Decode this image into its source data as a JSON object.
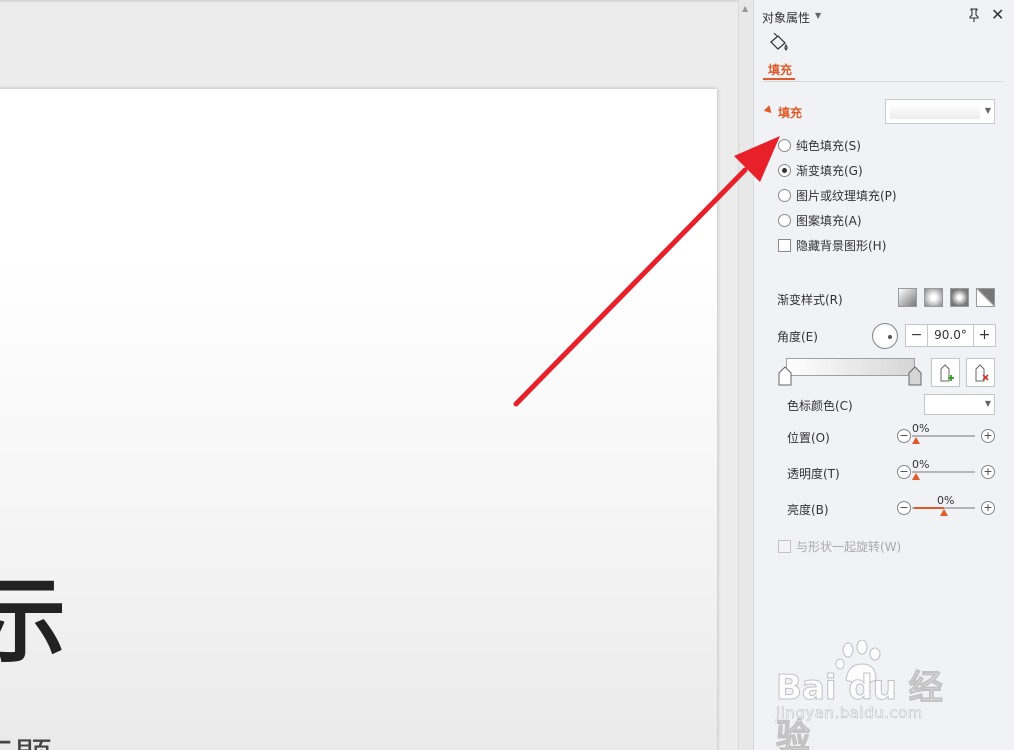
{
  "slide": {
    "title_fragment": "示",
    "subtitle_fragment": "标题"
  },
  "panel": {
    "title": "对象属性",
    "tab_fill_label": "填充",
    "fill_section_label": "填充",
    "fill_options": [
      {
        "label": "纯色填充(S)",
        "checked": false
      },
      {
        "label": "渐变填充(G)",
        "checked": true
      },
      {
        "label": "图片或纹理填充(P)",
        "checked": false
      },
      {
        "label": "图案填充(A)",
        "checked": false
      }
    ],
    "hide_background_label": "隐藏背景图形(H)",
    "gradient_style_label": "渐变样式(R)",
    "angle_label": "角度(E)",
    "angle_value": "90.0°",
    "stop_color_label": "色标颜色(C)",
    "sliders": [
      {
        "label": "位置(O)",
        "value": "0%",
        "percent": 0
      },
      {
        "label": "透明度(T)",
        "value": "0%",
        "percent": 0
      },
      {
        "label": "亮度(B)",
        "value": "0%",
        "percent": 50
      }
    ],
    "rotate_with_shape_label": "与形状一起旋转(W)"
  },
  "watermark": {
    "brand": "Bai du 经验",
    "url": "jingyan.baidu.com"
  },
  "colors": {
    "accent": "#e05a2a",
    "annotation_arrow": "#e8202a"
  }
}
